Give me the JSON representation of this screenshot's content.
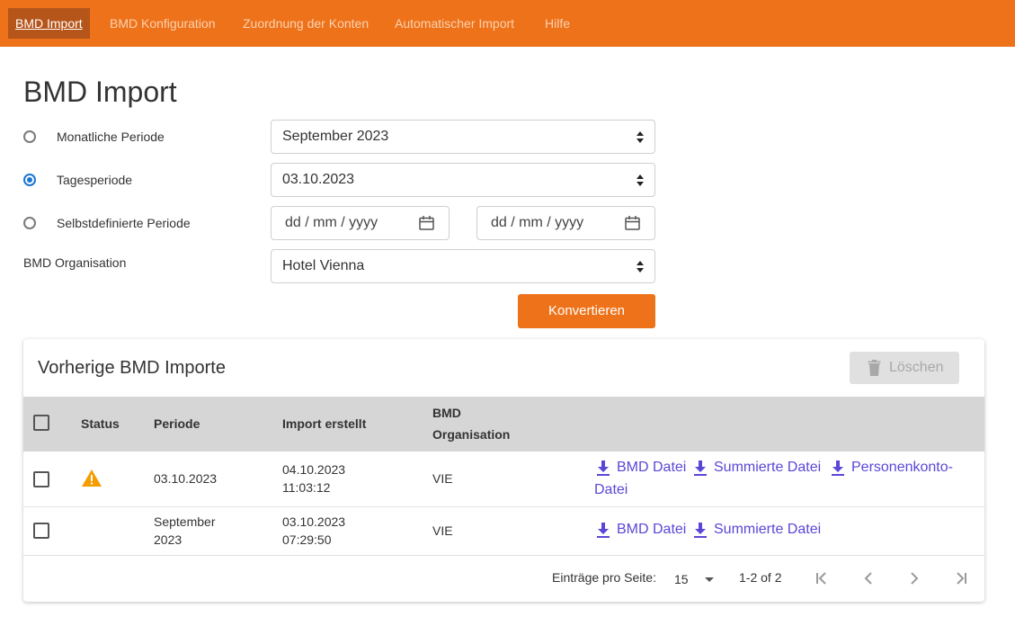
{
  "nav": {
    "tabs": [
      {
        "label": "BMD Import",
        "active": true
      },
      {
        "label": "BMD Konfiguration"
      },
      {
        "label": "Zuordnung der Konten"
      },
      {
        "label": "Automatischer Import"
      },
      {
        "label": "Hilfe"
      }
    ]
  },
  "page_title": "BMD Import",
  "form": {
    "monthly_label": "Monatliche Periode",
    "monthly_value": "September 2023",
    "daily_label": "Tagesperiode",
    "daily_value": "03.10.2023",
    "custom_label": "Selbstdefinierte Periode",
    "date_from_placeholder": "dd / mm / yyyy",
    "date_to_placeholder": "dd / mm / yyyy",
    "org_label": "BMD Organisation",
    "org_value": "Hotel Vienna",
    "convert_label": "Konvertieren",
    "selected_period": "Tagesperiode"
  },
  "history": {
    "title": "Vorherige BMD Importe",
    "delete_label": "Löschen",
    "columns": {
      "status": "Status",
      "period": "Periode",
      "created": "Import erstellt",
      "org_line1": "BMD",
      "org_line2": "Organisation"
    },
    "rows": [
      {
        "status": "warning-icon",
        "period_line1": "03.10.2023",
        "period_line2": "",
        "created_date": "04.10.2023",
        "created_time": "11:03:12",
        "org": "VIE",
        "links": [
          "BMD Datei",
          "Summierte Datei",
          "Personenkonto-"
        ],
        "link_wrap": "Datei"
      },
      {
        "status": "",
        "period_line1": "September",
        "period_line2": "2023",
        "created_date": "03.10.2023",
        "created_time": "07:29:50",
        "org": "VIE",
        "links": [
          "BMD Datei",
          "Summierte Datei"
        ]
      }
    ],
    "pagination": {
      "per_page_label": "Einträge pro Seite:",
      "per_page_value": "15",
      "range": "1-2 of 2"
    }
  },
  "colors": {
    "brand_orange": "#ee7219",
    "active_tab": "#b5551a",
    "link": "#5a47d6",
    "warning": "#f59c00",
    "radio_checked": "#1976d2"
  }
}
